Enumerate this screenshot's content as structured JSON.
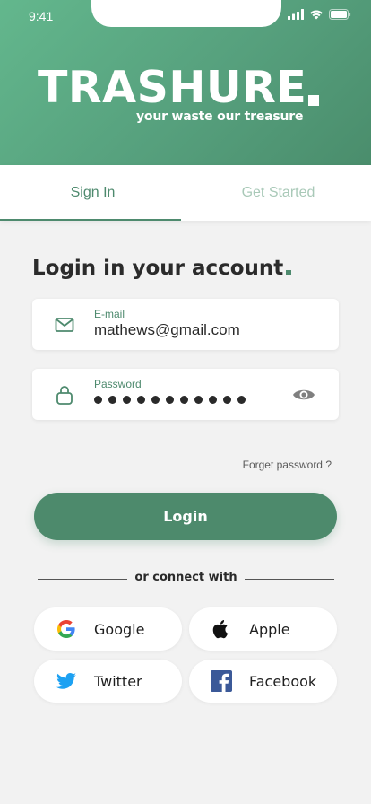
{
  "status_bar": {
    "time": "9:41"
  },
  "brand": {
    "title": "TRASHURE",
    "tagline": "your waste our treasure"
  },
  "tabs": [
    {
      "label": "Sign In",
      "active": true
    },
    {
      "label": "Get Started",
      "active": false
    }
  ],
  "form": {
    "title": "Login in your account",
    "email": {
      "label": "E-mail",
      "value": "mathews@gmail.com",
      "icon": "mail-icon"
    },
    "password": {
      "label": "Password",
      "masked_length": 11,
      "icon": "lock-icon",
      "toggle_icon": "eye-icon"
    },
    "forgot_label": "Forget password ?",
    "login_label": "Login"
  },
  "divider_text": "or connect with",
  "social": [
    {
      "label": "Google",
      "icon": "google-icon"
    },
    {
      "label": "Apple",
      "icon": "apple-icon"
    },
    {
      "label": "Twitter",
      "icon": "twitter-icon"
    },
    {
      "label": "Facebook",
      "icon": "facebook-icon"
    }
  ],
  "colors": {
    "brand_green": "#4d8a6c",
    "hero_light": "#63b78d",
    "tab_inactive": "#a9c9b8",
    "background": "#f2f2f2"
  }
}
